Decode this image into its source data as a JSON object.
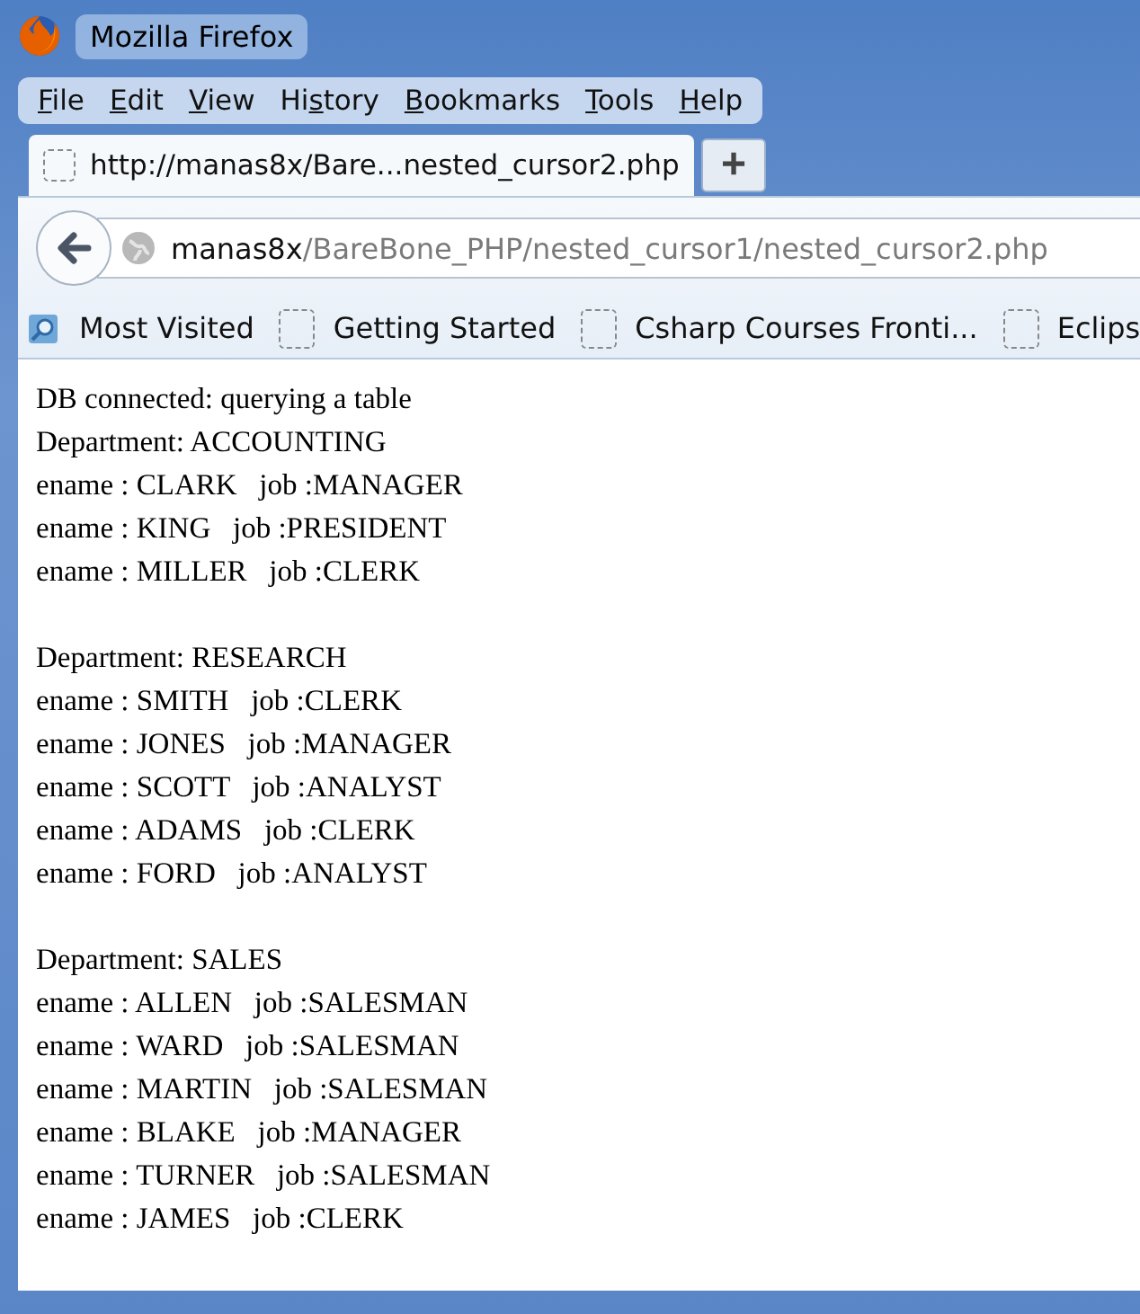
{
  "window": {
    "title": "Mozilla Firefox"
  },
  "menu": [
    {
      "key": "F",
      "after": "ile"
    },
    {
      "key": "E",
      "after": "dit"
    },
    {
      "key": "V",
      "after": "iew"
    },
    {
      "before": "Hi",
      "key": "s",
      "after": "tory"
    },
    {
      "key": "B",
      "after": "ookmarks"
    },
    {
      "key": "T",
      "after": "ools"
    },
    {
      "key": "H",
      "after": "elp"
    }
  ],
  "tabs": [
    {
      "label": "http://manas8x/Bare...nested_cursor2.php",
      "selected": true
    }
  ],
  "new_tab": "+",
  "address": {
    "host": "manas8x",
    "path": "/BareBone_PHP/nested_cursor1/nested_cursor2.php"
  },
  "bookmarks": [
    {
      "label": "Most Visited",
      "kind": "folder"
    },
    {
      "label": "Getting Started",
      "kind": "page"
    },
    {
      "label": "Csharp Courses Fronti...",
      "kind": "page"
    },
    {
      "label": "Eclips",
      "kind": "page"
    }
  ],
  "content": {
    "status": "DB connected: querying a table",
    "departments": [
      {
        "heading": "Department: ACCOUNTING",
        "rows": [
          "ename : CLARK   job :MANAGER",
          "ename : KING   job :PRESIDENT",
          "ename : MILLER   job :CLERK"
        ]
      },
      {
        "heading": "Department: RESEARCH",
        "rows": [
          "ename : SMITH   job :CLERK",
          "ename : JONES   job :MANAGER",
          "ename : SCOTT   job :ANALYST",
          "ename : ADAMS   job :CLERK",
          "ename : FORD   job :ANALYST"
        ]
      },
      {
        "heading": "Department: SALES",
        "rows": [
          "ename : ALLEN   job :SALESMAN",
          "ename : WARD   job :SALESMAN",
          "ename : MARTIN   job :SALESMAN",
          "ename : BLAKE   job :MANAGER",
          "ename : TURNER   job :SALESMAN",
          "ename : JAMES   job :CLERK"
        ]
      }
    ]
  }
}
